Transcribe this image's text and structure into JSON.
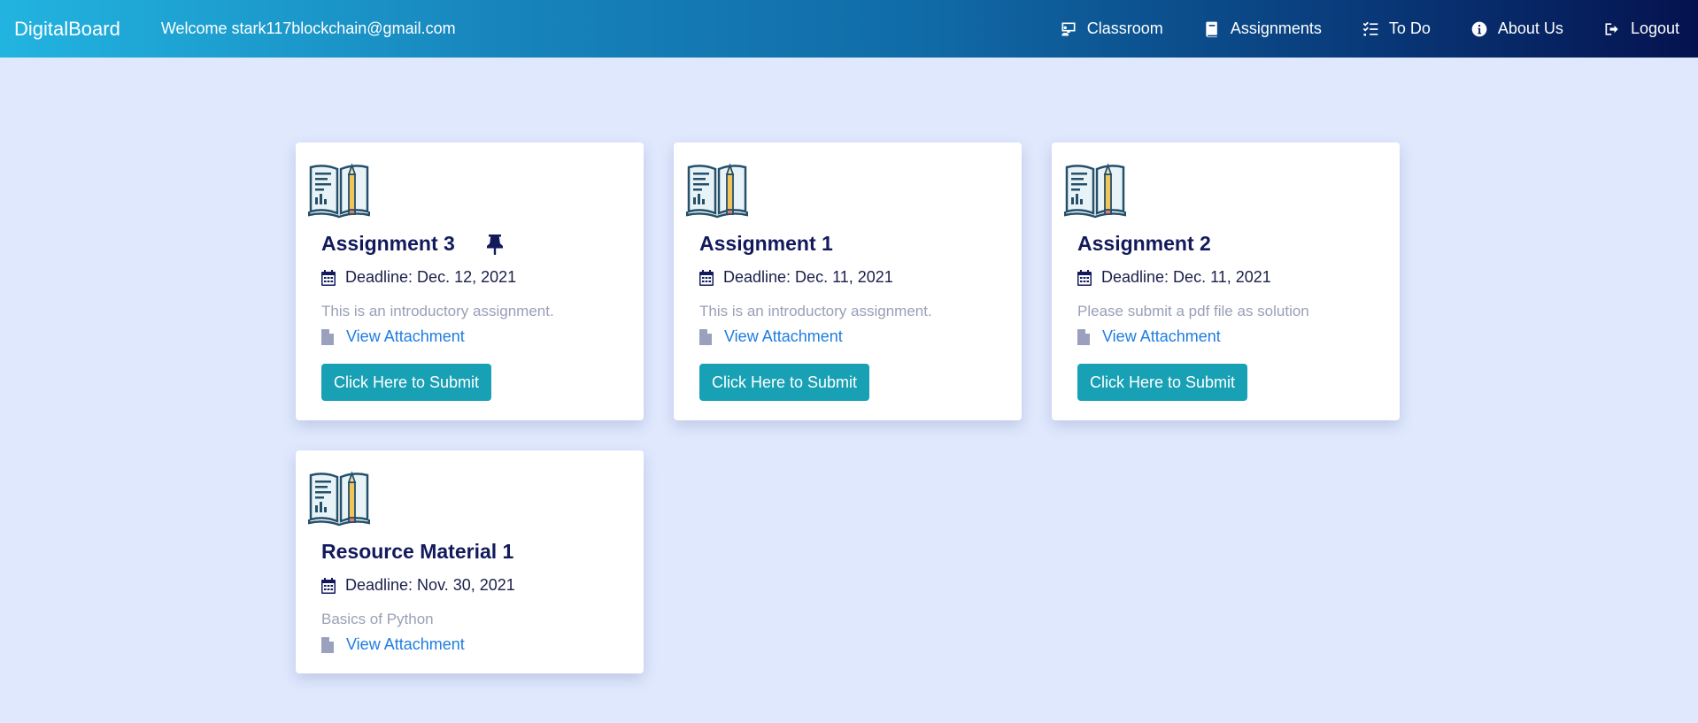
{
  "navbar": {
    "brand": "DigitalBoard",
    "welcome": "Welcome stark117blockchain@gmail.com",
    "items": [
      {
        "label": "Classroom",
        "icon": "classroom-icon"
      },
      {
        "label": "Assignments",
        "icon": "book-icon"
      },
      {
        "label": "To Do",
        "icon": "tasks-icon"
      },
      {
        "label": "About Us",
        "icon": "info-icon"
      },
      {
        "label": "Logout",
        "icon": "logout-icon"
      }
    ]
  },
  "cards": [
    {
      "title": "Assignment 3",
      "pinned": true,
      "deadline": "Deadline: Dec. 12, 2021",
      "description": "This is an introductory assignment.",
      "attachment_label": "View Attachment",
      "submit_label": "Click Here to Submit"
    },
    {
      "title": "Assignment 1",
      "pinned": false,
      "deadline": "Deadline: Dec. 11, 2021",
      "description": "This is an introductory assignment.",
      "attachment_label": "View Attachment",
      "submit_label": "Click Here to Submit"
    },
    {
      "title": "Assignment 2",
      "pinned": false,
      "deadline": "Deadline: Dec. 11, 2021",
      "description": "Please submit a pdf file as solution",
      "attachment_label": "View Attachment",
      "submit_label": "Click Here to Submit"
    },
    {
      "title": "Resource Material 1",
      "pinned": false,
      "deadline": "Deadline: Nov. 30, 2021",
      "description": "Basics of Python",
      "attachment_label": "View Attachment"
    }
  ],
  "colors": {
    "background": "#dfe8fd",
    "title": "#121a5c",
    "link": "#1f7de0",
    "button": "#18a0b4",
    "muted": "#9a9fb7"
  }
}
